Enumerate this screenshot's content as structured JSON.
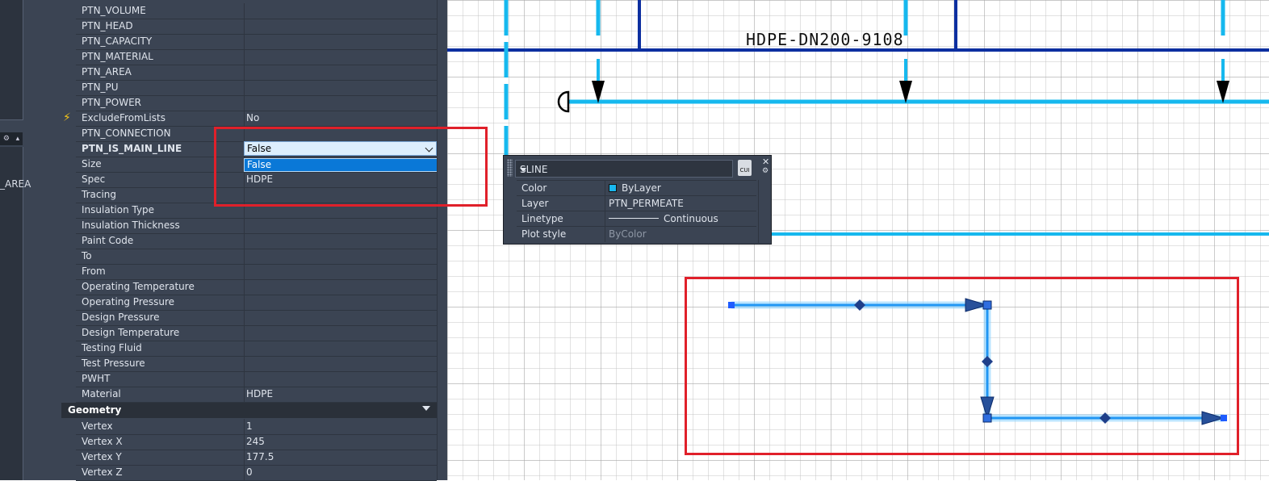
{
  "left_strip": {
    "area_label": "_AREA"
  },
  "properties": {
    "rows": [
      {
        "name": "PTN_VOLUME",
        "value": ""
      },
      {
        "name": "PTN_HEAD",
        "value": ""
      },
      {
        "name": "PTN_CAPACITY",
        "value": ""
      },
      {
        "name": "PTN_MATERIAL",
        "value": ""
      },
      {
        "name": "PTN_AREA",
        "value": ""
      },
      {
        "name": "PTN_PU",
        "value": ""
      },
      {
        "name": "PTN_POWER",
        "value": ""
      },
      {
        "name": "ExcludeFromLists",
        "value": "No"
      },
      {
        "name": "PTN_CONNECTION",
        "value": ""
      },
      {
        "name": "PTN_IS_MAIN_LINE",
        "value": "False"
      },
      {
        "name": "Size",
        "value": ""
      },
      {
        "name": "Spec",
        "value": "HDPE"
      },
      {
        "name": "Tracing",
        "value": ""
      },
      {
        "name": "Insulation Type",
        "value": ""
      },
      {
        "name": "Insulation Thickness",
        "value": ""
      },
      {
        "name": "Paint Code",
        "value": ""
      },
      {
        "name": "To",
        "value": ""
      },
      {
        "name": "From",
        "value": ""
      },
      {
        "name": "Operating Temperature",
        "value": ""
      },
      {
        "name": "Operating Pressure",
        "value": ""
      },
      {
        "name": "Design Pressure",
        "value": ""
      },
      {
        "name": "Design Temperature",
        "value": ""
      },
      {
        "name": "Testing Fluid",
        "value": ""
      },
      {
        "name": "Test Pressure",
        "value": ""
      },
      {
        "name": "PWHT",
        "value": ""
      },
      {
        "name": "Material",
        "value": "HDPE"
      }
    ],
    "dropdown": {
      "selected": "False",
      "options": [
        "False"
      ]
    },
    "geometry": {
      "title": "Geometry",
      "rows": [
        {
          "name": "Vertex",
          "value": "1"
        },
        {
          "name": "Vertex X",
          "value": "245"
        },
        {
          "name": "Vertex Y",
          "value": "177.5"
        },
        {
          "name": "Vertex Z",
          "value": "0"
        }
      ]
    }
  },
  "quick_properties": {
    "object_type": "SLINE",
    "cui_label": "CUI",
    "rows": [
      {
        "name": "Color",
        "value": "ByLayer"
      },
      {
        "name": "Layer",
        "value": "PTN_PERMEATE"
      },
      {
        "name": "Linetype",
        "value": "Continuous"
      },
      {
        "name": "Plot style",
        "value": "ByColor"
      }
    ],
    "swatch_color": "#19b7ef"
  },
  "drawing": {
    "pipe_label": "HDPE-DN200-9108",
    "colors": {
      "dark_pipe": "#0d2fa0",
      "light_pipe": "#16b8ee",
      "highlight": "#e0202a"
    }
  }
}
